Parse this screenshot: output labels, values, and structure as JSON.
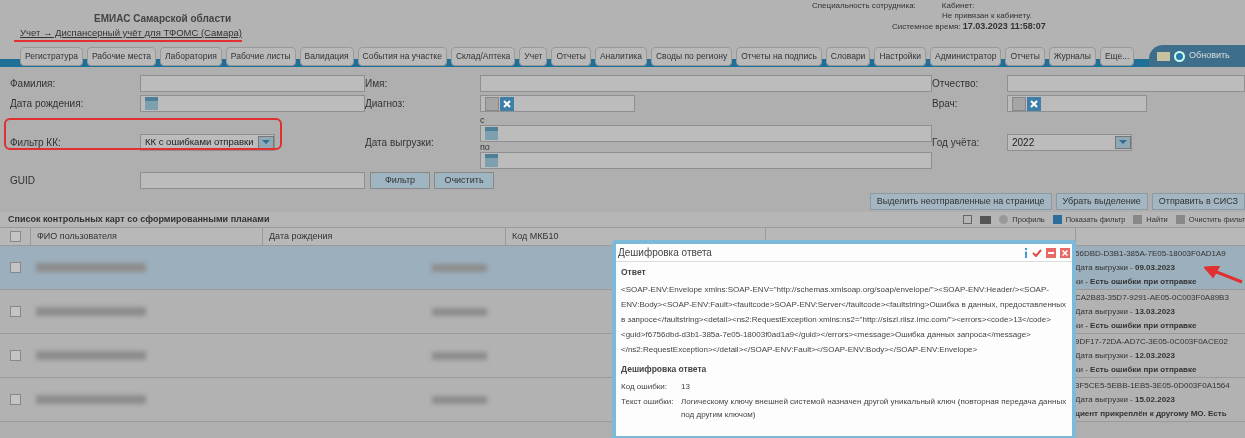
{
  "header": {
    "org": "ЕМИАС Самарской области",
    "breadcrumb": "Учет → Диспансерный учёт для ТФОМС (Самара)",
    "specialty_label": "Специальность сотрудника:",
    "cabinet_label": "Кабинет:",
    "cabinet_value": "Не привязан к кабинету.",
    "time_label": "Системное время:",
    "time_value": "17.03.2023 11:58:07"
  },
  "nav": [
    "Регистратура",
    "Рабочие места",
    "Лаборатория",
    "Рабочие листы",
    "Валидация",
    "События на участке",
    "Склад/Аптека",
    "Учет",
    "Отчеты",
    "Аналитика",
    "Своды по региону",
    "Отчеты на подпись",
    "Словари",
    "Настройки",
    "Администратор",
    "Отчеты",
    "Журналы",
    "Еще..."
  ],
  "refresh": "Обновить",
  "form": {
    "surname": "Фамилия:",
    "name": "Имя:",
    "patronymic": "Отчество:",
    "birth": "Дата рождения:",
    "diagnosis": "Диагноз:",
    "doctor": "Врач:",
    "kk_filter": {
      "label": "Фильтр КК:",
      "value": "КК с ошибками отправки"
    },
    "export_date": {
      "label": "Дата выгрузки:",
      "from": "с",
      "to": "по"
    },
    "year": {
      "label": "Год учёта:",
      "value": "2022"
    },
    "guid": "GUID",
    "filter_button": "Фильтр",
    "clear_button": "Очистить"
  },
  "actions": [
    "Выделить неотправленные на странице",
    "Убрать выделение",
    "Отправить в СИСЗ"
  ],
  "table": {
    "title": "Список контрольных карт со сформированными планами",
    "toolbar": [
      "Профиль",
      "Показать фильтр",
      "Найти",
      "Очистить фильт"
    ],
    "select_all_checked": false,
    "columns": [
      "ФИО пользователя",
      "Дата рождения",
      "Код МКБ10"
    ],
    "rows": [
      {
        "selected": true,
        "checked": false,
        "guid": "56DBD-D3B1-385A-7E05-18003F0AD1A9",
        "date": "Дата выгрузки - **09.03.2023**",
        "status": "ки - **Есть ошибки при отправке**"
      },
      {
        "selected": false,
        "checked": false,
        "guid": "CA2B83-35D7-9291-AE05-0C003F0A89B3",
        "date": "Дата выгрузки - **13.03.2023**",
        "status": "ки - **Есть ошибки при отправке**"
      },
      {
        "selected": false,
        "checked": false,
        "guid": "9DF17-72DA-AD7C-3E05-0C003F0ACE02",
        "date": "Дата выгрузки - **12.03.2023**",
        "status": "ки - **Есть ошибки при отправке**"
      },
      {
        "selected": false,
        "checked": false,
        "guid": "3F5CE5-5EBB-1EB5-3E05-0D003F0A1564",
        "date": "Дата выгрузки - **15.02.2023**",
        "status": "**циент прикреплён к другому МО. Есть**"
      }
    ]
  },
  "dialog": {
    "title": "Дешифровка ответа",
    "response_heading": "Ответ",
    "response": "<SOAP-ENV:Envelope xmlns:SOAP-ENV=\"http://schemas.xmlsoap.org/soap/envelope/\"><SOAP-ENV:Header/><SOAP-ENV:Body><SOAP-ENV:Fault><faultcode>SOAP-ENV:Server</faultcode><faultstring>Ошибка в данных, предоставленных в запросе</faultstring><detail><ns2:RequestException xmlns:ns2=\"http://siszl.riisz.imc.com/\"><errors><code>13</code><guid>f6756dbd-d3b1-385a-7e05-18003f0ad1a9</guid></errors><message>Ошибка данных запроса</message></ns2:RequestException></detail></SOAP-ENV:Fault></SOAP-ENV:Body></SOAP-ENV:Envelope>",
    "decode_heading": "Дешифровка ответа",
    "fields": [
      {
        "label": "Код ошибки:",
        "value": "13"
      },
      {
        "label": "Текст ошибки:",
        "value": "Логическому ключу внешней системой назначен другой уникальный ключ (повторная передача данных под другим ключом)"
      }
    ]
  }
}
